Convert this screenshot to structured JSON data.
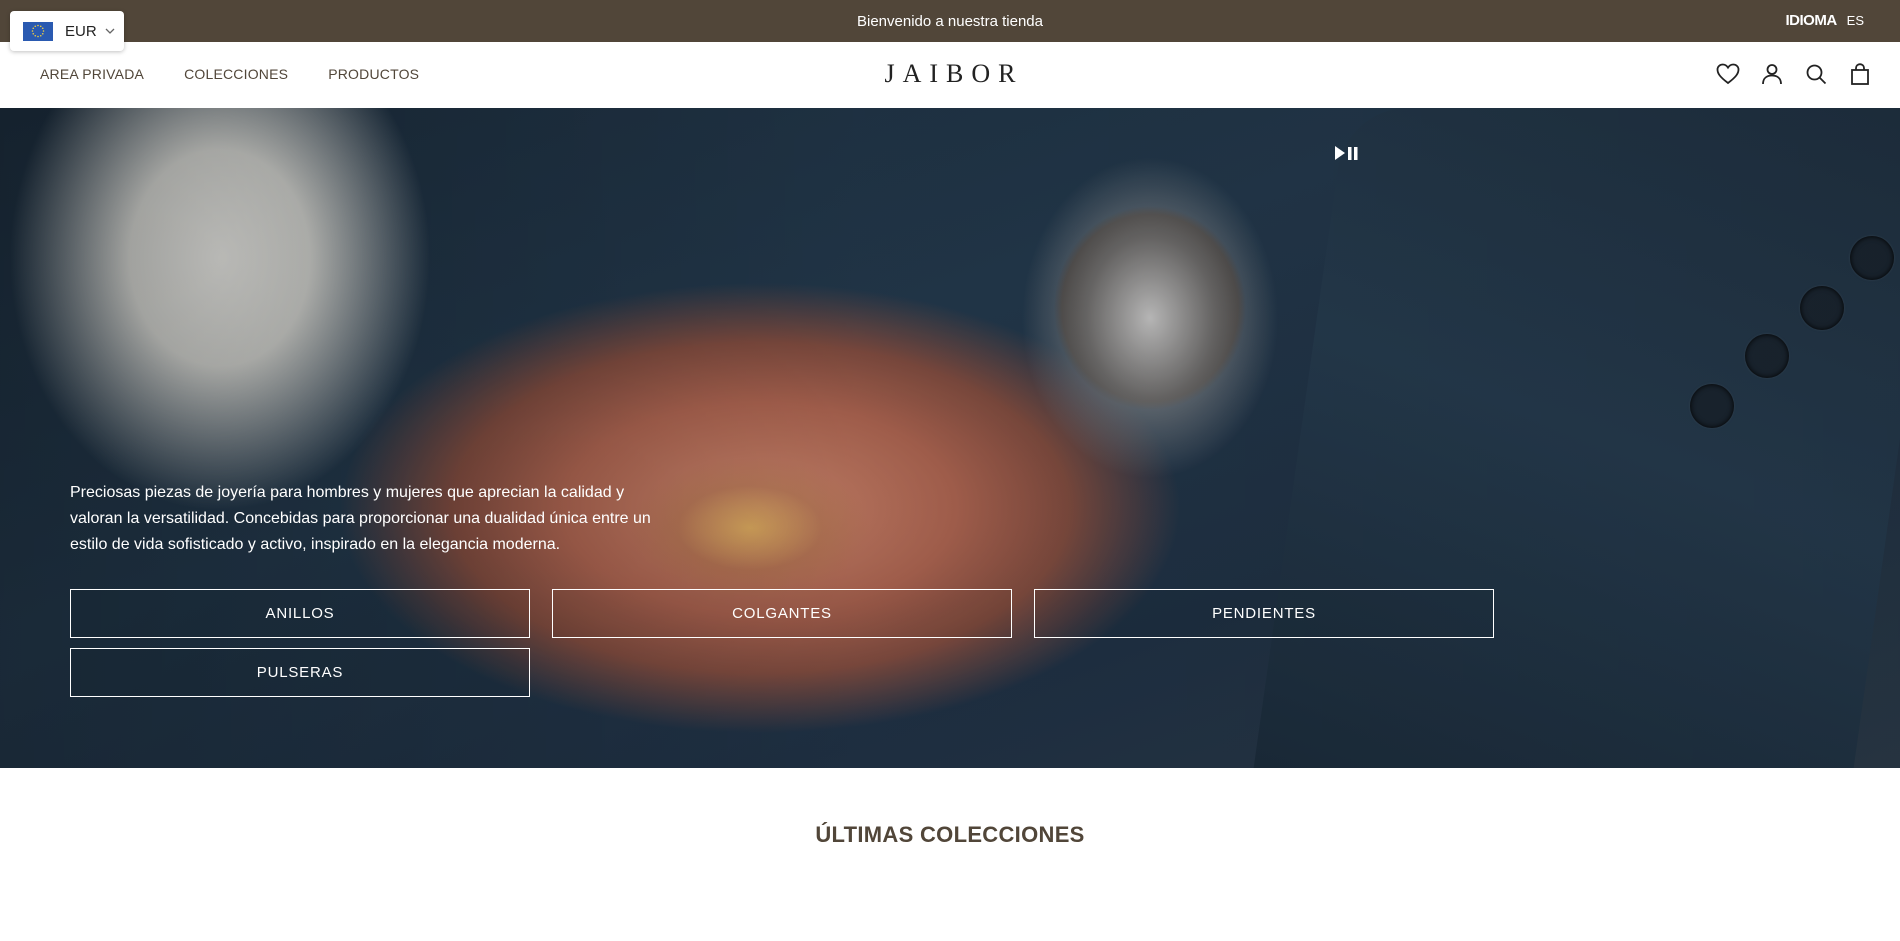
{
  "announcement": {
    "message": "Bienvenido a nuestra tienda"
  },
  "language": {
    "label": "IDIOMA",
    "code": "ES"
  },
  "currency": {
    "code": "EUR"
  },
  "nav": {
    "items": [
      "AREA PRIVADA",
      "COLECCIONES",
      "PRODUCTOS"
    ]
  },
  "brand": {
    "logo": "JAIBOR"
  },
  "header_icons": [
    "heart-icon",
    "account-icon",
    "search-icon",
    "bag-icon"
  ],
  "hero": {
    "description": "Preciosas piezas de joyería para hombres y mujeres que aprecian la calidad y valoran la versatilidad. Concebidas para proporcionar una dualidad única entre un estilo de vida sofisticado y activo, inspirado en la elegancia moderna.",
    "categories": [
      "ANILLOS",
      "COLGANTES",
      "PENDIENTES",
      "PULSERAS"
    ]
  },
  "section": {
    "title": "ÚLTIMAS COLECCIONES"
  },
  "colors": {
    "topbar": "#514639",
    "text_brand": "#514639",
    "flag": "#2a5ab1"
  }
}
